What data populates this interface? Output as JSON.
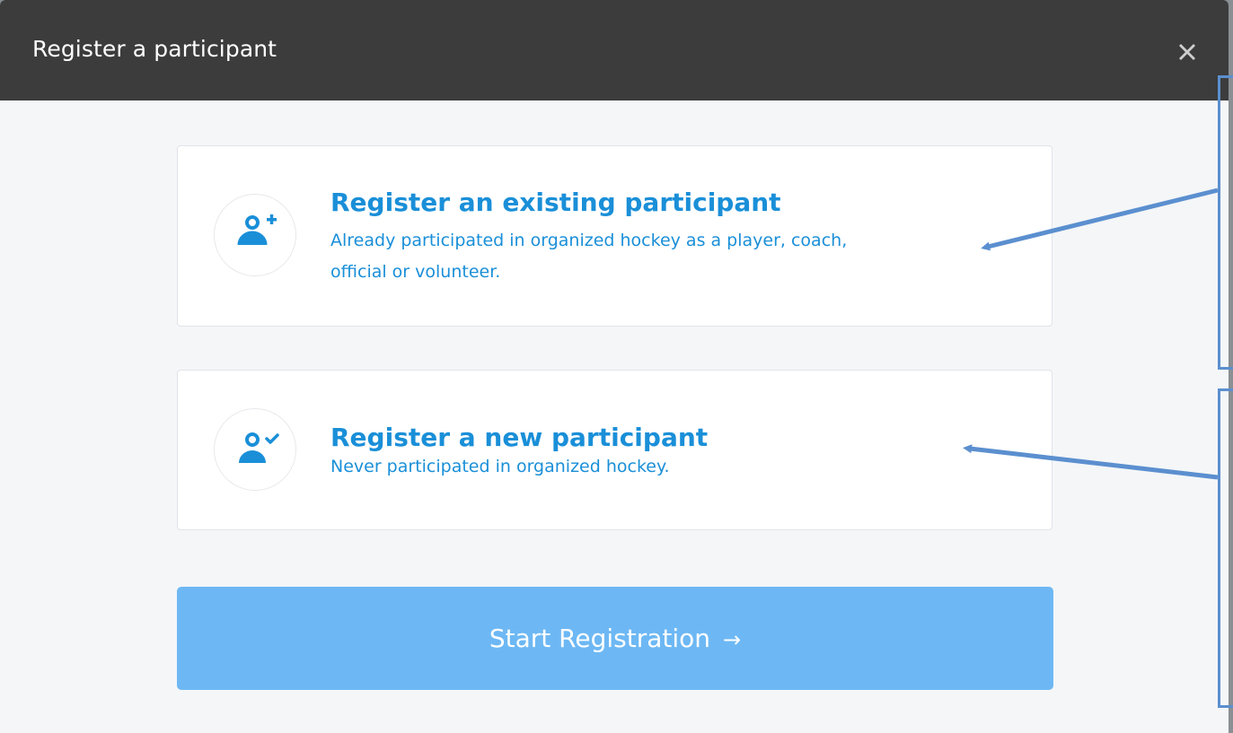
{
  "modal": {
    "title": "Register a participant",
    "close_icon": "close-x-icon"
  },
  "options": [
    {
      "title": "Register an existing participant",
      "description": "Already participated in organized hockey as a player, coach, official or volunteer.",
      "icon": "user-plus-icon"
    },
    {
      "title": "Register a new participant",
      "description": "Never participated in organized hockey.",
      "icon": "user-check-icon"
    }
  ],
  "start_button": {
    "label": "Start Registration",
    "arrow": "→",
    "icon": "arrow-right-icon"
  },
  "colors": {
    "header_bg": "#3c3c3c",
    "accent_text": "#1a8fd8",
    "button_bg": "#6db8f4",
    "annotation": "#5b8fcf"
  }
}
